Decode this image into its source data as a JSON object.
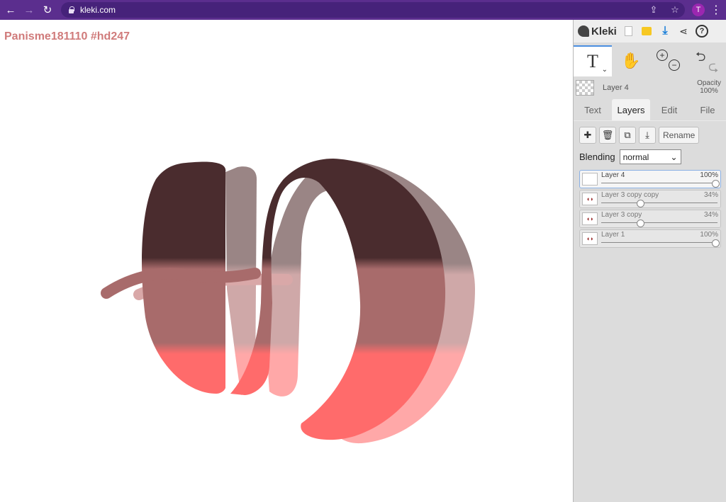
{
  "browser": {
    "url": "kleki.com",
    "profile_initial": "T",
    "icons": [
      "back-arrow-icon",
      "forward-arrow-icon",
      "reload-icon",
      "lock-icon",
      "share-icon",
      "star-icon",
      "menu-dots-icon"
    ]
  },
  "canvas": {
    "title": "Panisme181110 #hd247",
    "colors": {
      "dark": "#4a2c2e",
      "mid": "#a86b6b",
      "pink": "#ff6b6b",
      "ghost": "#9a8585",
      "title": "#d07b7b"
    }
  },
  "panel": {
    "logo": "Kleki",
    "top_icons": [
      "new-image-icon",
      "open-folder-icon",
      "download-icon",
      "share-icon",
      "help-icon"
    ],
    "help_label": "?",
    "tools": {
      "text_tool": "T",
      "caret": "⌄",
      "hand_icon": "✋",
      "zoom_in": "+",
      "zoom_out": "−",
      "undo": "⮌",
      "redo": "⮎"
    },
    "current_layer": {
      "name": "Layer 4",
      "opacity_label": "Opacity",
      "opacity_value": "100%"
    },
    "tabs": [
      {
        "label": "Text",
        "active": false
      },
      {
        "label": "Layers",
        "active": true
      },
      {
        "label": "Edit",
        "active": false
      },
      {
        "label": "File",
        "active": false
      }
    ],
    "layer_actions": {
      "add": "✚",
      "delete": "🗑",
      "duplicate": "⧉",
      "merge": "⤓",
      "rename": "Rename"
    },
    "blending": {
      "label": "Blending",
      "value": "normal",
      "chevron": "⌄"
    },
    "layers": [
      {
        "name": "Layer 4",
        "opacity": "100%",
        "value": 1.0,
        "selected": true,
        "thumb": ""
      },
      {
        "name": "Layer 3 copy copy",
        "opacity": "34%",
        "value": 0.34,
        "selected": false,
        "thumb": "◖◗"
      },
      {
        "name": "Layer 3 copy",
        "opacity": "34%",
        "value": 0.34,
        "selected": false,
        "thumb": "◖◗"
      },
      {
        "name": "Layer 1",
        "opacity": "100%",
        "value": 1.0,
        "selected": false,
        "thumb": "◖◗"
      }
    ]
  }
}
